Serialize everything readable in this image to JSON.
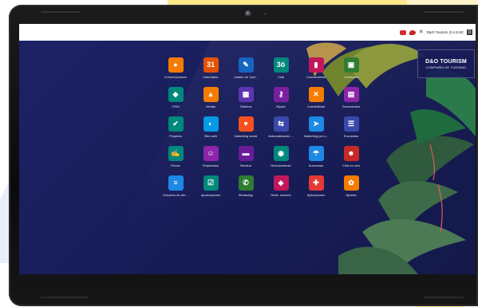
{
  "topbar": {
    "company": "D&O Tourism (3.4.5.9C",
    "close_symbol": "✕",
    "avatar_text": "D"
  },
  "brand": {
    "title": "D&O TOURISM",
    "subtitle": "COMPAÑÍA DE TURISMO"
  },
  "apps": [
    {
      "label": "Conversaciones",
      "glyph": "●",
      "icon": "chat-bubble-icon",
      "color": "#f57c00"
    },
    {
      "label": "Calendario",
      "glyph": "31",
      "icon": "calendar-icon",
      "color": "#e65100"
    },
    {
      "label": "Listado de \"pen...",
      "glyph": "✎",
      "icon": "pencil-icon",
      "color": "#1565c0"
    },
    {
      "label": "Chat",
      "glyph": "3ö",
      "icon": "chat-icon",
      "color": "#00897b"
    },
    {
      "label": "Conocimiento",
      "glyph": "▮",
      "icon": "bookmark-icon",
      "color": "#c2185b"
    },
    {
      "label": "Contactos",
      "glyph": "▣",
      "icon": "contacts-icon",
      "color": "#2e7d32"
    },
    {
      "label": "CRM",
      "glyph": "◆",
      "icon": "handshake-icon",
      "color": "#00897b"
    },
    {
      "label": "Ventas",
      "glyph": "▲",
      "icon": "sales-chart-icon",
      "color": "#f57c00"
    },
    {
      "label": "Tableros",
      "glyph": "▦",
      "icon": "dashboard-icon",
      "color": "#5e35b1"
    },
    {
      "label": "Rquito",
      "glyph": "⚷",
      "icon": "key-icon",
      "color": "#7b1fa2"
    },
    {
      "label": "Contabilidad",
      "glyph": "✕",
      "icon": "accounting-icon",
      "color": "#f57c00"
    },
    {
      "label": "Documentos",
      "glyph": "▤",
      "icon": "documents-icon",
      "color": "#8e24aa"
    },
    {
      "label": "Proyecto",
      "glyph": "✔",
      "icon": "checkmark-icon",
      "color": "#00897b"
    },
    {
      "label": "Sitio web",
      "glyph": "◐",
      "icon": "website-icon",
      "color": "#039be5"
    },
    {
      "label": "Marketing social",
      "glyph": "♥",
      "icon": "heart-icon",
      "color": "#f4511e"
    },
    {
      "label": "Automatización ...",
      "glyph": "⇆",
      "icon": "automation-icon",
      "color": "#3949ab"
    },
    {
      "label": "Marketing por c...",
      "glyph": "➤",
      "icon": "send-icon",
      "color": "#1e88e5"
    },
    {
      "label": "Encuestas",
      "glyph": "☰",
      "icon": "survey-icon",
      "color": "#3949ab"
    },
    {
      "label": "Firmar",
      "glyph": "✍",
      "icon": "signature-icon",
      "color": "#00897b"
    },
    {
      "label": "Empleados",
      "glyph": "☺",
      "icon": "employees-icon",
      "color": "#8e24aa"
    },
    {
      "label": "Nómina",
      "glyph": "▬",
      "icon": "payroll-icon",
      "color": "#6a1b9a"
    },
    {
      "label": "Reclutamiento",
      "glyph": "◉",
      "icon": "recruitment-icon",
      "color": "#00897b"
    },
    {
      "label": "Ausencias",
      "glyph": "☂",
      "icon": "umbrella-icon",
      "color": "#1e88e5"
    },
    {
      "label": "Chat en vivo",
      "glyph": "☻",
      "icon": "live-chat-icon",
      "color": "#c62828"
    },
    {
      "label": "Empleos de der...",
      "glyph": "≡",
      "icon": "jobs-icon",
      "color": "#1e88e5"
    },
    {
      "label": "Aprobaciones",
      "glyph": "☑",
      "icon": "approvals-icon",
      "color": "#00897b"
    },
    {
      "label": "WhatsApp",
      "glyph": "✆",
      "icon": "whatsapp-icon",
      "color": "#2e7d32"
    },
    {
      "label": "Redir. enlaces",
      "glyph": "◈",
      "icon": "link-icon",
      "color": "#c2185b"
    },
    {
      "label": "Aplicaciones",
      "glyph": "✚",
      "icon": "apps-icon",
      "color": "#e53935"
    },
    {
      "label": "Ajustes",
      "glyph": "✿",
      "icon": "settings-gear-icon",
      "color": "#f57c00"
    }
  ]
}
